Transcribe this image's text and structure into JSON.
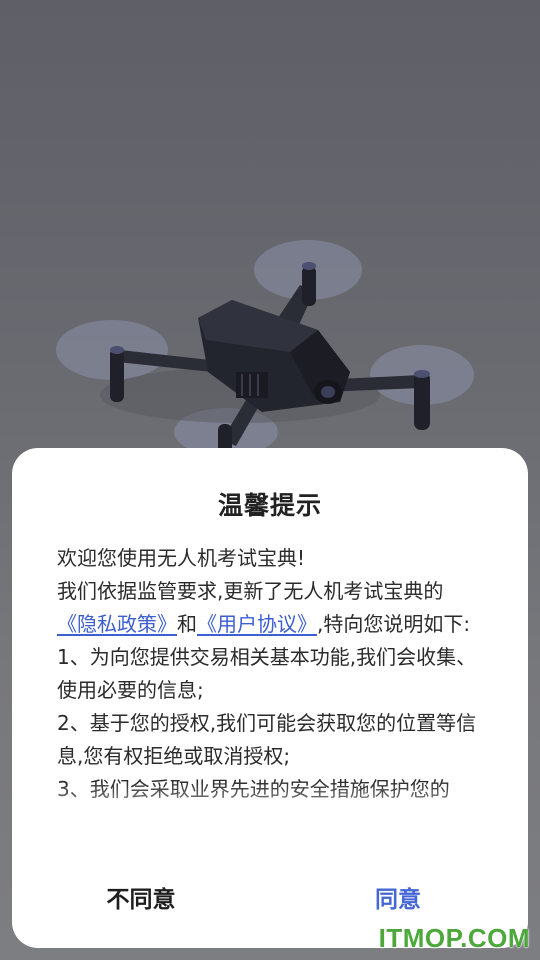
{
  "dialog": {
    "title": "温馨提示",
    "greeting": "欢迎您使用无人机考试宝典!",
    "intro_before": "我们依据监管要求,更新了无人机考试宝典的",
    "privacy_link": "《隐私政策》",
    "and_text": "和",
    "agreement_link": "《用户协议》",
    "intro_after": ",特向您说明如下:",
    "item1": "1、为向您提供交易相关基本功能,我们会收集、使用必要的信息;",
    "item2": "2、基于您的授权,我们可能会获取您的位置等信息,您有权拒绝或取消授权;",
    "item3": "3、我们会采取业界先进的安全措施保护您的",
    "decline_label": "不同意",
    "agree_label": "同意"
  },
  "watermark": "ITMOP.COM",
  "colors": {
    "link": "#3d5fd0",
    "agree": "#4467d6",
    "watermark": "#4ca83a",
    "backdrop": "#5e5f66"
  },
  "background_image": "drone-illustration"
}
